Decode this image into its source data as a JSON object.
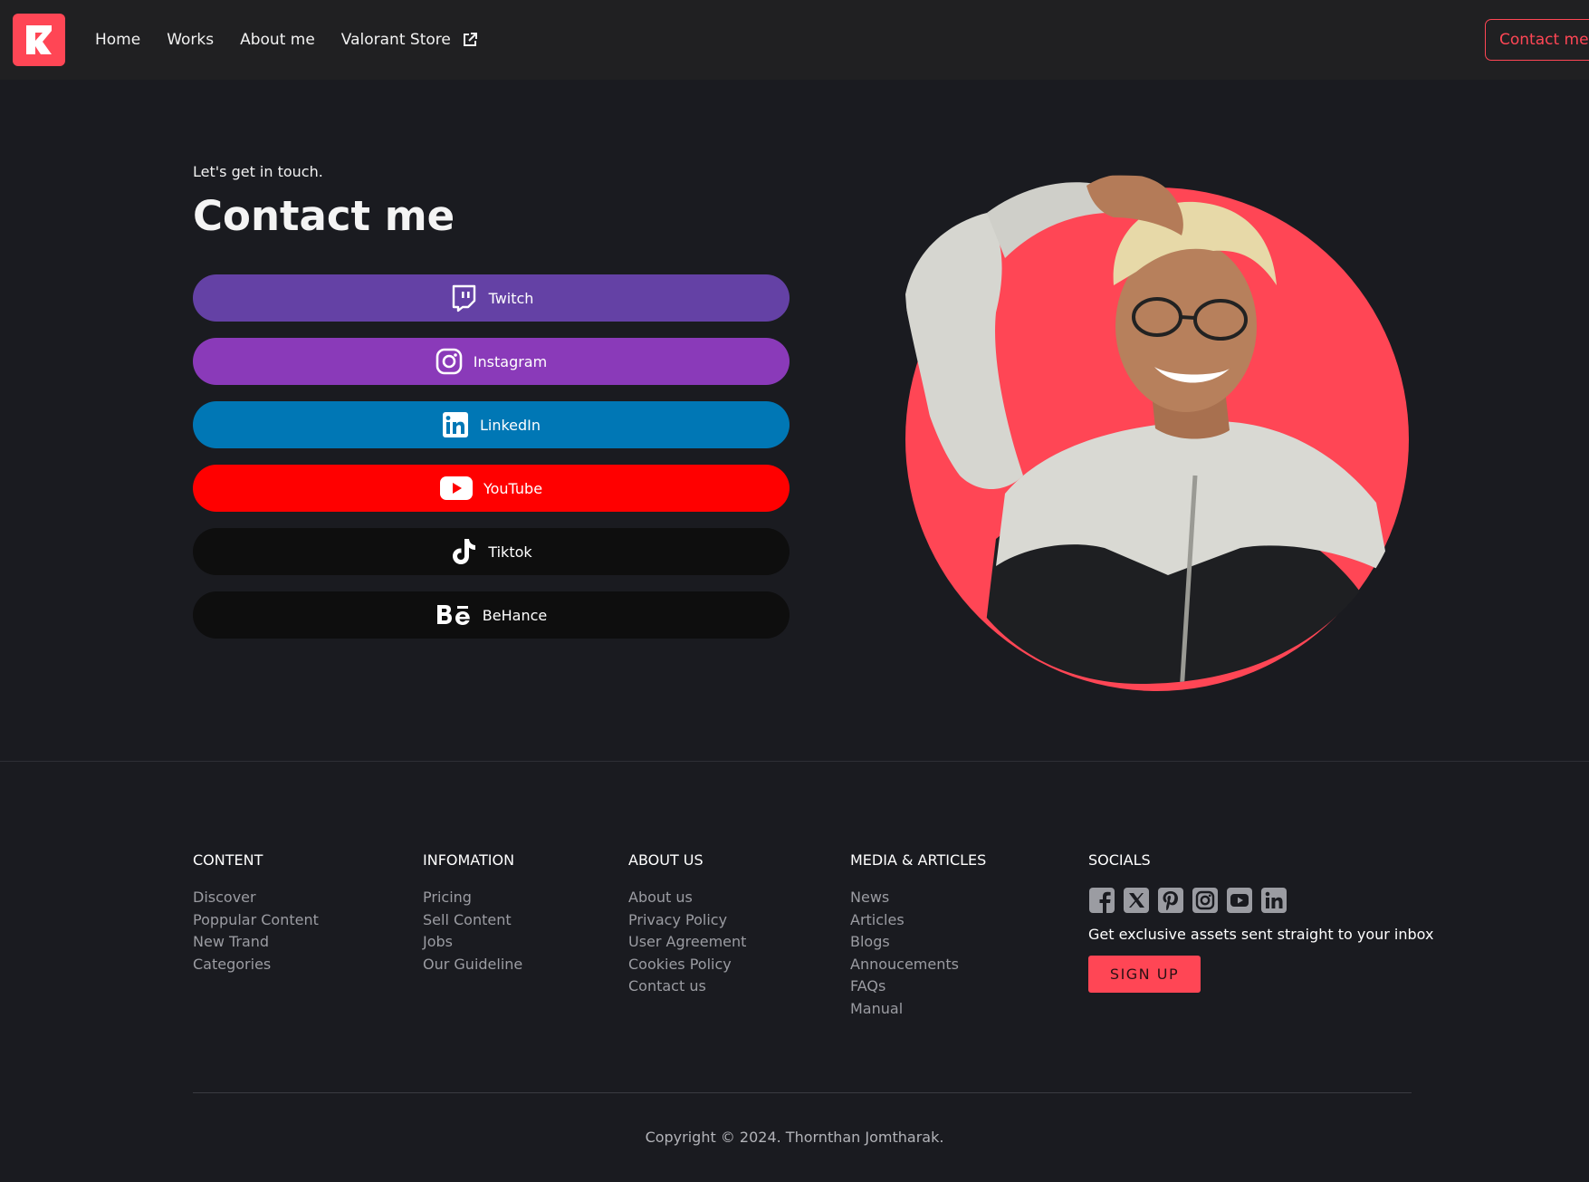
{
  "colors": {
    "accent": "#ff4655",
    "background": "#1a1b20",
    "navbar": "#202022",
    "twitch": "#6441a5",
    "instagram": "#8a3ab9",
    "linkedin": "#0077b5",
    "youtube": "#ff0000",
    "tiktok": "#0e0e0e",
    "behance": "#0e0e0e"
  },
  "header": {
    "nav": [
      "Home",
      "Works",
      "About me",
      "Valorant Store"
    ],
    "contact_label": "Contact me"
  },
  "hero": {
    "eyebrow": "Let's get in touch.",
    "title": "Contact me",
    "buttons": [
      {
        "label": "Twitch",
        "icon": "twitch-icon"
      },
      {
        "label": "Instagram",
        "icon": "instagram-icon"
      },
      {
        "label": "LinkedIn",
        "icon": "linkedin-icon"
      },
      {
        "label": "YouTube",
        "icon": "youtube-icon"
      },
      {
        "label": "Tiktok",
        "icon": "tiktok-icon"
      },
      {
        "label": "BeHance",
        "icon": "behance-icon"
      }
    ]
  },
  "footer": {
    "columns": [
      {
        "title": "CONTENT",
        "links": [
          "Discover",
          "Poppular Content",
          "New Trand",
          "Categories"
        ]
      },
      {
        "title": "INFOMATION",
        "links": [
          "Pricing",
          "Sell Content",
          "Jobs",
          "Our Guideline"
        ]
      },
      {
        "title": "ABOUT US",
        "links": [
          "About us",
          "Privacy Policy",
          "User Agreement",
          "Cookies Policy",
          "Contact us"
        ]
      },
      {
        "title": "MEDIA & ARTICLES",
        "links": [
          "News",
          "Articles",
          "Blogs",
          "Annoucements",
          "FAQs",
          "Manual"
        ]
      }
    ],
    "socials": {
      "title": "SOCIALS",
      "icons": [
        "facebook-icon",
        "x-icon",
        "pinterest-icon",
        "instagram-icon",
        "youtube-icon",
        "linkedin-icon"
      ],
      "text": "Get exclusive assets sent straight to your inbox",
      "signup_label": "SIGN UP"
    },
    "copyright": "Copyright © 2024. Thornthan Jomtharak."
  }
}
